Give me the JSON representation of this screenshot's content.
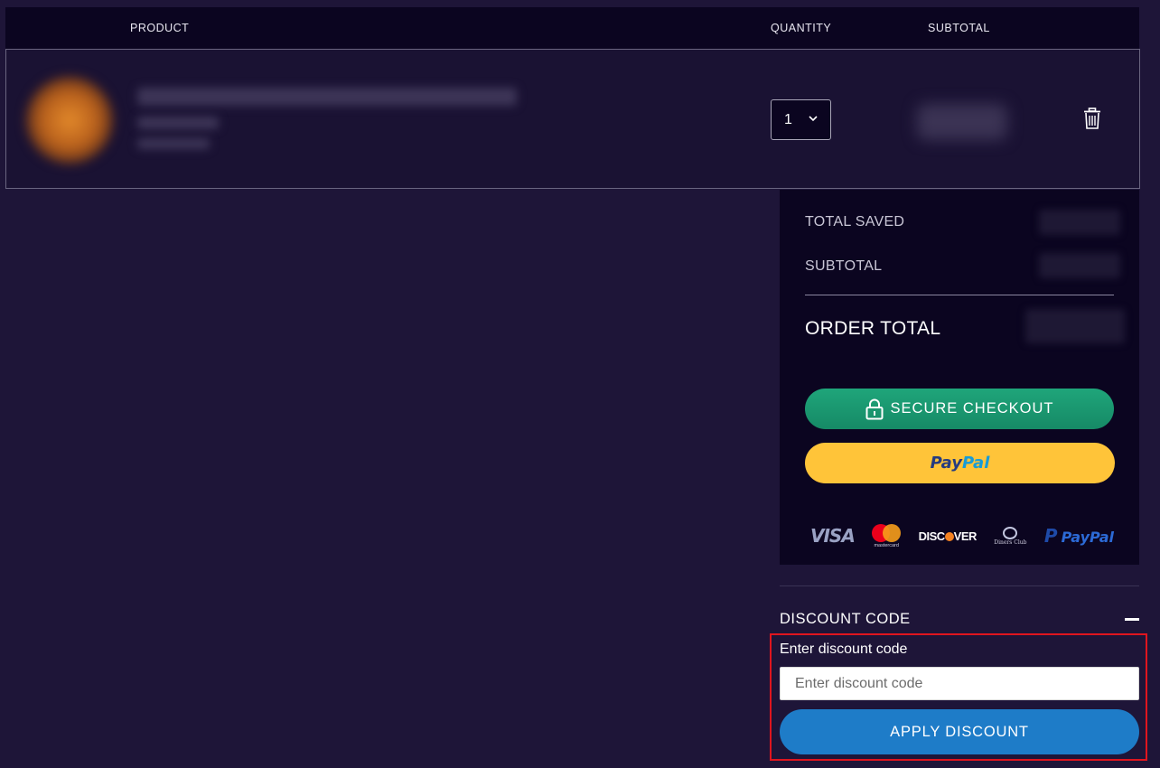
{
  "table": {
    "headers": {
      "product": "PRODUCT",
      "quantity": "QUANTITY",
      "subtotal": "SUBTOTAL"
    },
    "row": {
      "quantity": "1"
    }
  },
  "summary": {
    "total_saved_label": "TOTAL SAVED",
    "subtotal_label": "SUBTOTAL",
    "order_total_label": "ORDER TOTAL",
    "checkout_label": "SECURE CHECKOUT",
    "paypal_button": {
      "part1": "Pay",
      "part2": "Pal"
    },
    "payment_icons": {
      "visa": "VISA",
      "mastercard": "mastercard",
      "discover_a": "DISC",
      "discover_b": "VER",
      "diners": "Diners Club",
      "paypal_a": "Pay",
      "paypal_b": "Pal"
    }
  },
  "discount": {
    "title": "DISCOUNT CODE",
    "label": "Enter discount code",
    "placeholder": "Enter discount code",
    "apply_label": "APPLY DISCOUNT"
  },
  "colors": {
    "background": "#1e1538",
    "panel": "#0b0520",
    "checkout_green": "#1fa57a",
    "paypal_yellow": "#ffc439",
    "apply_blue": "#1e7cc8",
    "highlight_red": "#e0151e"
  }
}
